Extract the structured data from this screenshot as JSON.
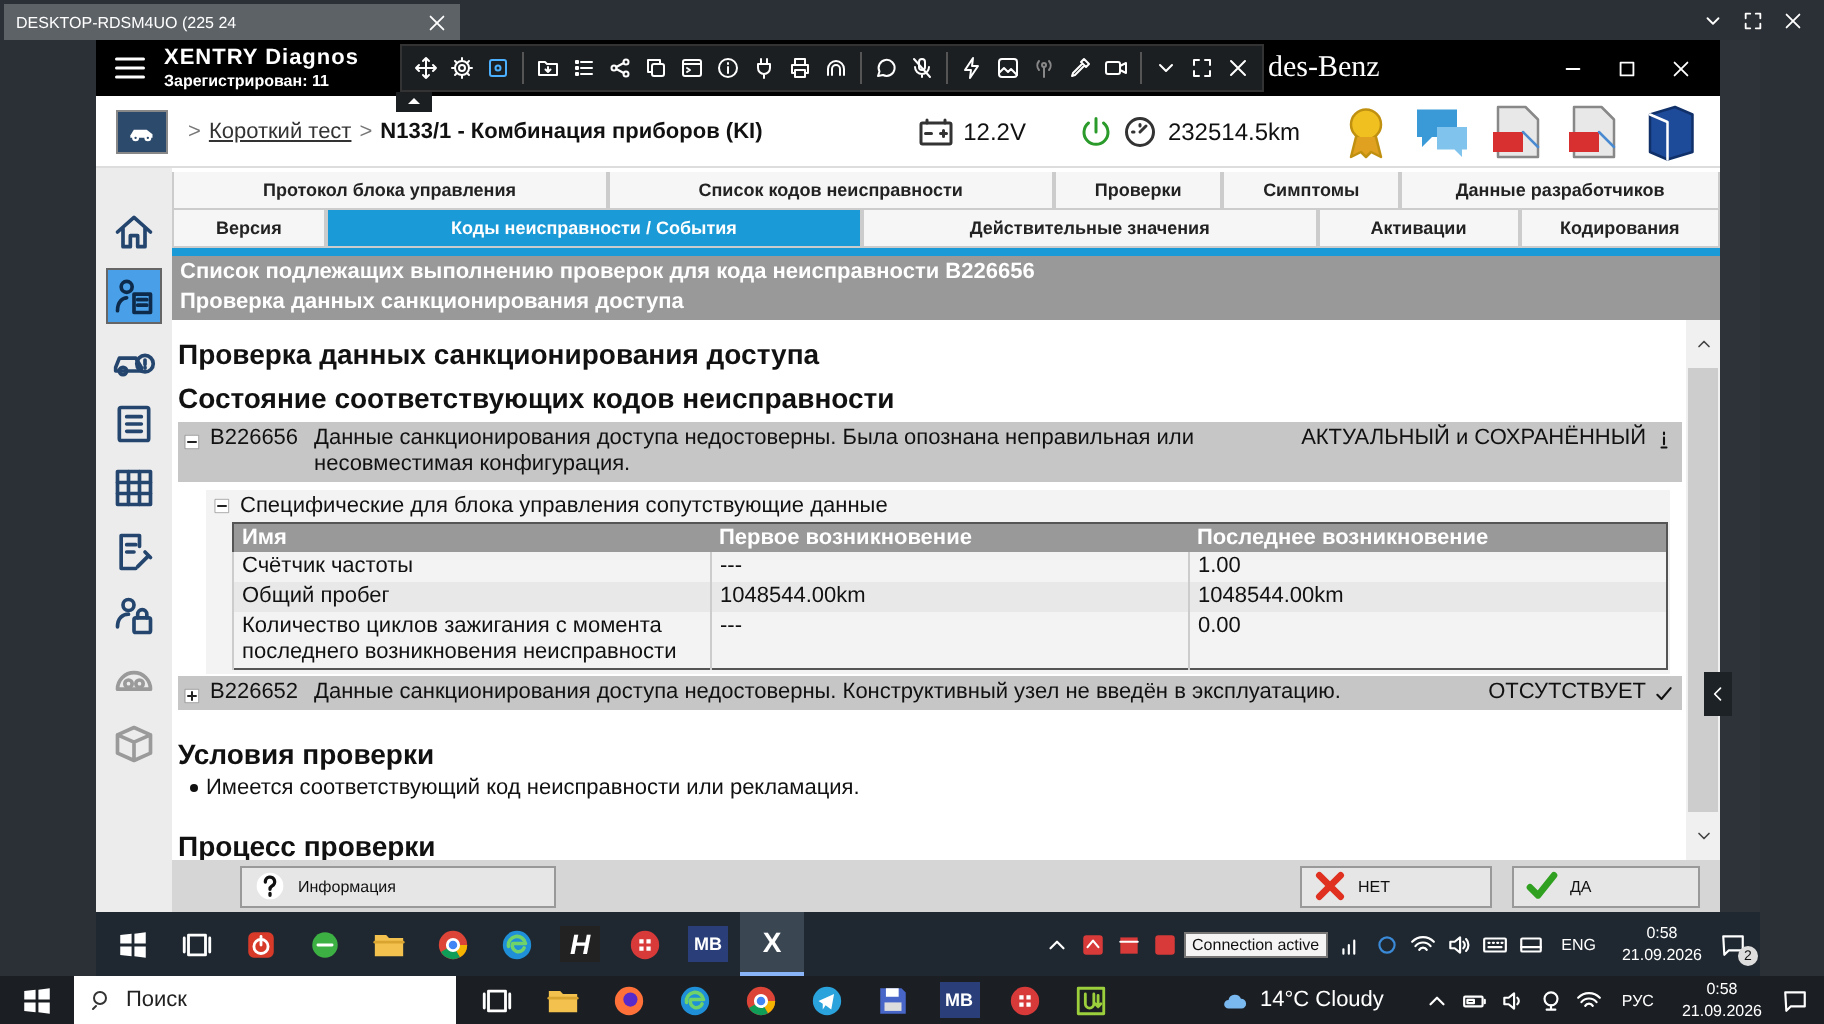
{
  "remote_session": {
    "tab_title": "DESKTOP-RDSM4UO (225 24"
  },
  "app": {
    "title": "XENTRY Diagnos",
    "registration": "Зарегистрирован: 11",
    "brand_fragment": "des-Benz"
  },
  "breadcrumb": {
    "separator": ">",
    "items": [
      {
        "label": "Короткий тест",
        "link": true
      },
      {
        "label": "N133/1 - Комбинация приборов (KI)",
        "link": false
      }
    ]
  },
  "vehicle_status": {
    "voltage": "12.2V",
    "mileage": "232514.5km"
  },
  "sidebar": {
    "items": [
      {
        "kind": "home",
        "selected": false,
        "disabled": false
      },
      {
        "kind": "diagnosis",
        "selected": true,
        "disabled": false
      },
      {
        "kind": "car-fault",
        "selected": false,
        "disabled": false
      },
      {
        "kind": "list",
        "selected": false,
        "disabled": false
      },
      {
        "kind": "grid",
        "selected": false,
        "disabled": false
      },
      {
        "kind": "document-wrench",
        "selected": false,
        "disabled": false
      },
      {
        "kind": "person-lock",
        "selected": false,
        "disabled": false
      },
      {
        "kind": "gauge",
        "selected": false,
        "disabled": true
      },
      {
        "kind": "box",
        "selected": false,
        "disabled": true
      }
    ]
  },
  "tabs": {
    "rows": [
      [
        {
          "label": "Протокол блока управления",
          "selected": false
        },
        {
          "label": "Список кодов неисправности",
          "selected": false
        },
        {
          "label": "Проверки",
          "selected": false
        },
        {
          "label": "Симптомы",
          "selected": false
        },
        {
          "label": "Данные разработчиков",
          "selected": false
        }
      ],
      [
        {
          "label": "Версия",
          "selected": false
        },
        {
          "label": "Коды неисправности / События",
          "selected": true
        },
        {
          "label": "Действительные значения",
          "selected": false
        },
        {
          "label": "Активации",
          "selected": false
        },
        {
          "label": "Кодирования",
          "selected": false
        }
      ]
    ]
  },
  "header": {
    "lines": [
      "Список подлежащих выполнению проверок для кода неисправности B226656",
      "Проверка данных санкционирования доступа"
    ]
  },
  "content": {
    "title": "Проверка данных санкционирования доступа",
    "subtitle": "Состояние соответствующих кодов неисправности",
    "faults": [
      {
        "code": "B226656",
        "description": "Данные санкционирования доступа недостоверны. Была опознана неправильная или несовместимая конфигурация.",
        "status": "АКТУАЛЬНЫЙ и СОХРАНЁННЫЙ",
        "active": true,
        "expanded": true,
        "details": {
          "title": "Специфические для блока управления сопутствующие данные",
          "expanded": true,
          "columns": [
            "Имя",
            "Первое возникновение",
            "Последнее возникновение"
          ],
          "rows": [
            [
              "Счётчик частоты",
              "---",
              "1.00"
            ],
            [
              "Общий пробег",
              "1048544.00km",
              "1048544.00km"
            ],
            [
              "Количество циклов зажигания с момента последнего возникновения неисправности",
              "---",
              "0.00"
            ]
          ]
        }
      },
      {
        "code": "B226652",
        "description": "Данные санкционирования доступа недостоверны. Конструктивный узел не введён в эксплуатацию.",
        "status": "ОТСУТСТВУЕТ",
        "active": false,
        "expanded": false
      }
    ],
    "sections": [
      {
        "title": "Условия проверки",
        "items": [
          "Имеется соответствующий код неисправности или рекламация."
        ]
      },
      {
        "title": "Процесс проверки"
      }
    ]
  },
  "buttons": [
    {
      "kind": "info",
      "label": "Информация"
    },
    {
      "kind": "no",
      "label": "НЕТ"
    },
    {
      "kind": "yes",
      "label": "ДА"
    }
  ],
  "remote_taskbar": {
    "apps": [
      {
        "kind": "windows",
        "selected": false
      },
      {
        "kind": "task-view",
        "selected": false
      },
      {
        "kind": "red-power",
        "selected": false
      },
      {
        "kind": "green-app",
        "selected": false
      },
      {
        "kind": "folder",
        "selected": false
      },
      {
        "kind": "chrome",
        "selected": false
      },
      {
        "kind": "edge",
        "selected": false
      },
      {
        "kind": "letter-dark",
        "label": "H",
        "selected": false
      },
      {
        "kind": "red-app",
        "selected": false
      },
      {
        "kind": "letter-blue",
        "label": "MB",
        "selected": false
      },
      {
        "kind": "xentry",
        "label": "X",
        "selected": true
      }
    ],
    "language": "ENG",
    "time": "0:58",
    "date": "21.09.2026",
    "notifications": "2",
    "tooltip": "Connection active"
  },
  "taskbar": {
    "search_placeholder": "Поиск",
    "apps": [
      {
        "kind": "task-view"
      },
      {
        "kind": "folder"
      },
      {
        "kind": "firefox"
      },
      {
        "kind": "edge"
      },
      {
        "kind": "chrome"
      },
      {
        "kind": "telegram"
      },
      {
        "kind": "floppy"
      },
      {
        "kind": "letter-blue",
        "label": "MB"
      },
      {
        "kind": "red-app"
      },
      {
        "kind": "green-u"
      }
    ],
    "weather": "14°C Cloudy",
    "language": "РУС",
    "time": "0:58",
    "date": "21.09.2026"
  }
}
